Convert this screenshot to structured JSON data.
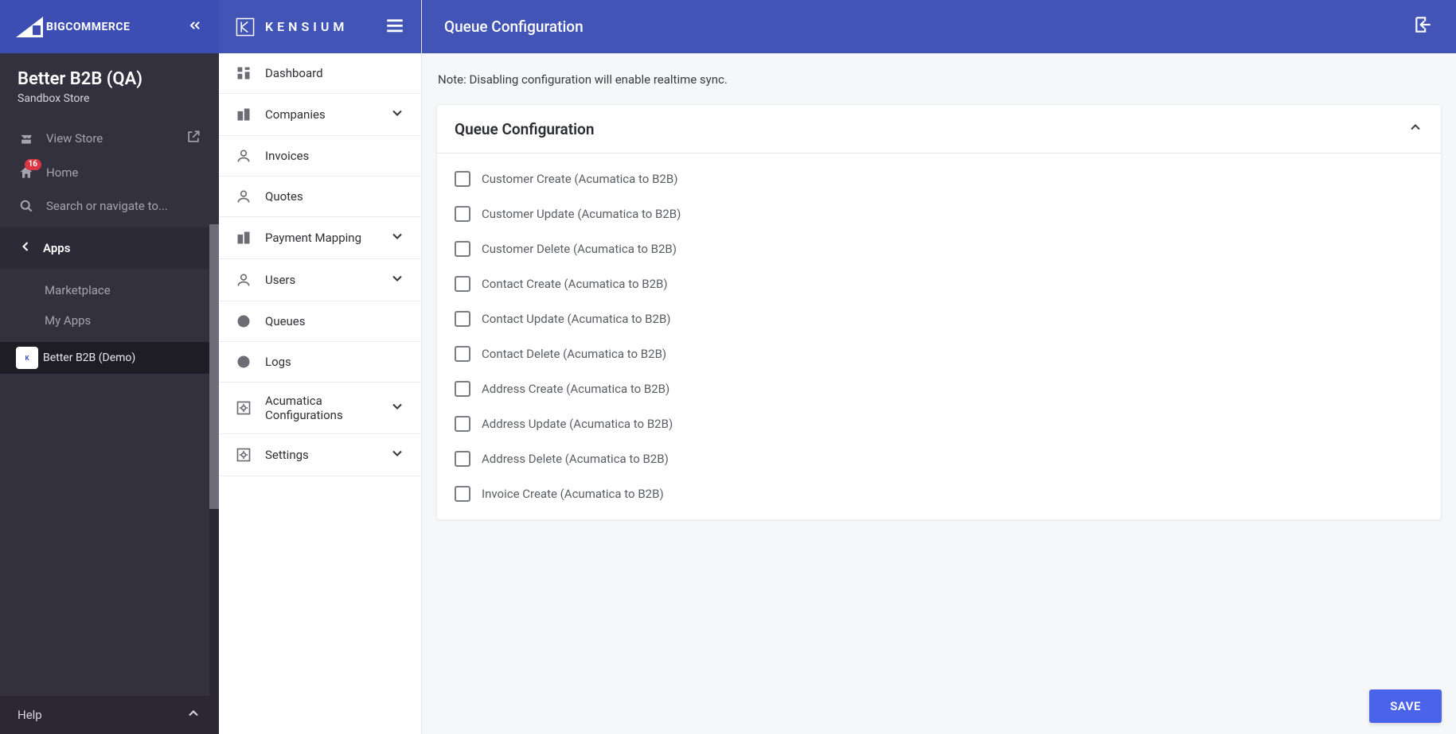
{
  "bc": {
    "brand": "COMMERCE",
    "brand_prefix": "BIG",
    "store_name": "Better B2B (QA)",
    "store_sub": "Sandbox Store",
    "view_store": "View Store",
    "home": "Home",
    "home_badge": "16",
    "search_placeholder": "Search or navigate to...",
    "apps_header": "Apps",
    "apps": {
      "marketplace": "Marketplace",
      "my_apps": "My Apps"
    },
    "active_app": "Better B2B (Demo)",
    "help": "Help"
  },
  "ks": {
    "brand": "KENSIUM",
    "nav": {
      "dashboard": "Dashboard",
      "companies": "Companies",
      "invoices": "Invoices",
      "quotes": "Quotes",
      "payment_mapping": "Payment Mapping",
      "users": "Users",
      "queues": "Queues",
      "logs": "Logs",
      "acumatica_configs": "Acumatica Configurations",
      "settings": "Settings"
    }
  },
  "main": {
    "title": "Queue Configuration",
    "note": "Note: Disabling configuration will enable realtime sync.",
    "panel_title": "Queue Configuration",
    "save": "SAVE",
    "options": [
      "Customer Create (Acumatica to B2B)",
      "Customer Update (Acumatica to B2B)",
      "Customer Delete (Acumatica to B2B)",
      "Contact Create (Acumatica to B2B)",
      "Contact Update (Acumatica to B2B)",
      "Contact Delete (Acumatica to B2B)",
      "Address Create (Acumatica to B2B)",
      "Address Update (Acumatica to B2B)",
      "Address Delete (Acumatica to B2B)",
      "Invoice Create (Acumatica to B2B)"
    ]
  }
}
